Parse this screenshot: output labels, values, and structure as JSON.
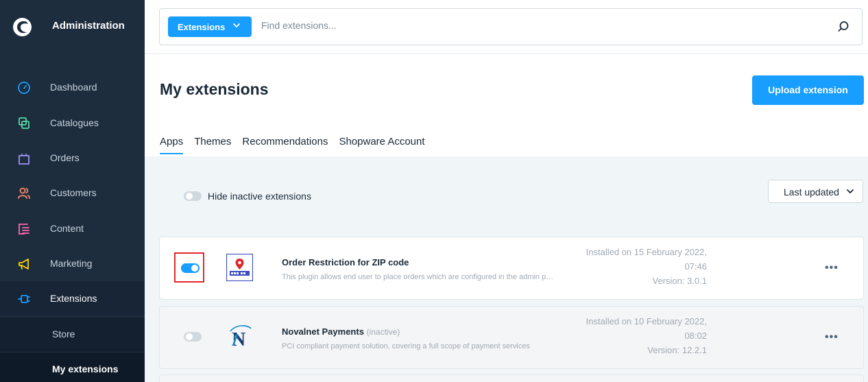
{
  "sidebar": {
    "title": "Administration",
    "items": [
      {
        "label": "Dashboard",
        "icon": "gauge-icon",
        "color": "#189eff"
      },
      {
        "label": "Catalogues",
        "icon": "catalogue-icon",
        "color": "#57d9a3"
      },
      {
        "label": "Orders",
        "icon": "shopping-bag-icon",
        "color": "#a092f0"
      },
      {
        "label": "Customers",
        "icon": "users-icon",
        "color": "#f88962"
      },
      {
        "label": "Content",
        "icon": "content-icon",
        "color": "#ff68b4"
      },
      {
        "label": "Marketing",
        "icon": "megaphone-icon",
        "color": "#ffd700"
      },
      {
        "label": "Extensions",
        "icon": "plug-icon",
        "color": "#189eff"
      }
    ],
    "sub_items": [
      {
        "label": "Store"
      },
      {
        "label": "My extensions"
      }
    ]
  },
  "search": {
    "button_label": "Extensions",
    "placeholder": "Find extensions..."
  },
  "page": {
    "title": "My extensions",
    "upload_label": "Upload extension"
  },
  "tabs": [
    {
      "label": "Apps",
      "active": true
    },
    {
      "label": "Themes"
    },
    {
      "label": "Recommendations"
    },
    {
      "label": "Shopware Account"
    }
  ],
  "filters": {
    "hide_inactive_label": "Hide inactive extensions",
    "sort_label": "Last updated"
  },
  "extensions": [
    {
      "name": "Order Restriction for ZIP code",
      "status": "",
      "description": "This plugin allows end user to place orders which are configured in the admin panel",
      "installed_line1": "Installed on 15 February 2022,",
      "installed_line2": "07:46",
      "version": "Version: 3.0.1",
      "active": true
    },
    {
      "name": "Novalnet Payments",
      "status": "(inactive)",
      "description": "PCI compliant payment solution, covering a full scope of payment services",
      "installed_line1": "Installed on 10 February 2022,",
      "installed_line2": "08:02",
      "version": "Version: 12.2.1",
      "active": false
    }
  ],
  "colors": {
    "accent": "#189eff",
    "sidebar_bg": "#1e2d3e",
    "highlight_border": "#e0272b"
  }
}
